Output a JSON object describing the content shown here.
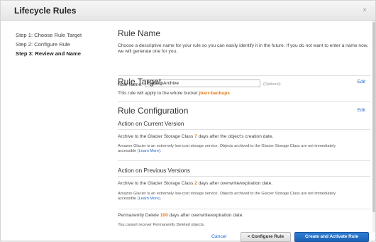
{
  "dialog": {
    "title": "Lifecycle Rules",
    "close": "×"
  },
  "steps": [
    {
      "label": "Step 1: Choose Rule Target"
    },
    {
      "label": "Step 2: Configure Rule"
    },
    {
      "label": "Step 3: Review and Name"
    }
  ],
  "rule_name": {
    "heading": "Rule Name",
    "description": "Choose a descriptive name for your rule so you can easily identify it in the future. If you do not want to enter a name now, we will generate one for you.",
    "label": "Rule Name:",
    "value": "BackupArchive",
    "optional": "(Optional)"
  },
  "rule_target": {
    "heading": "Rule Target",
    "edit": "Edit",
    "text_prefix": "This rule will apply to the whole bucket",
    "bucket": "jbarr-backups"
  },
  "rule_config": {
    "heading": "Rule Configuration",
    "edit": "Edit",
    "current": {
      "heading": "Action on Current Version",
      "prefix": "Archive to the Glacier Storage Class",
      "days": "7",
      "suffix": "days after the object's creation date.",
      "note": "Amazon Glacier is an extremely low-cost storage service. Objects archived to the Glacier Storage Class are not immediately accessible",
      "learn_more": "(Learn More)."
    },
    "previous": {
      "heading": "Action on Previous Versions",
      "prefix": "Archive to the Glacier Storage Class",
      "days": "2",
      "suffix": "days after overwrite/expiration date.",
      "note": "Amazon Glacier is an extremely low-cost storage service. Objects archived to the Glacier Storage Class are not immediately accessible",
      "learn_more": "(Learn More)."
    },
    "delete": {
      "prefix": "Permanently Delete",
      "days": "100",
      "suffix": "days after overwrite/expiration date.",
      "note": "You cannot recover Permanently Deleted objects."
    }
  },
  "footer": {
    "cancel": "Cancel",
    "configure": "< Configure Rule",
    "create": "Create and Activate Rule"
  }
}
